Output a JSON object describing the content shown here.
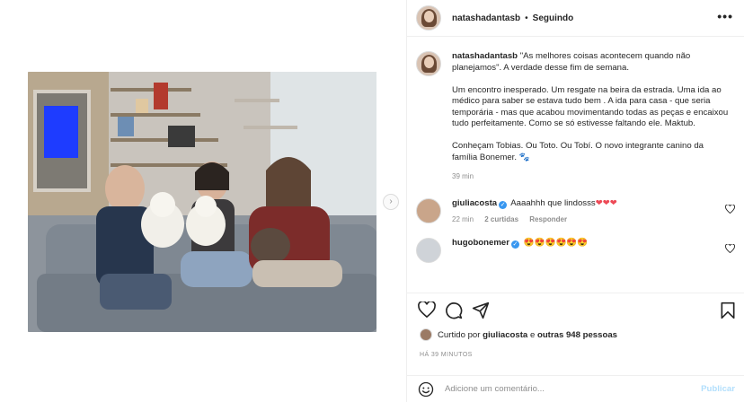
{
  "post": {
    "username": "natashadantasb",
    "separator": "•",
    "follow_status": "Seguindo",
    "more_glyph": "•••"
  },
  "caption": {
    "username": "natashadantasb",
    "paragraph1": "\"As melhores coisas acontecem quando não planejamos\". A verdade desse fim de semana.",
    "paragraph2": "Um encontro inesperado. Um resgate na beira da estrada. Uma ida ao médico para saber se estava tudo bem . A ida para casa - que seria temporária - mas que acabou movimentando todas as peças e encaixou tudo perfeitamente. Como se só estivesse faltando ele. Maktub.",
    "paragraph3": "Conheçam Tobias. Ou Toto. Ou Tobí. O novo integrante canino da família Bonemer. 🐾",
    "time": "39 min"
  },
  "comments": [
    {
      "username": "giuliacosta",
      "verified": true,
      "text": "Aaaahhh que lindosss",
      "hearts": "❤❤❤",
      "time": "22 min",
      "likes": "2 curtidas",
      "reply": "Responder"
    },
    {
      "username": "hugobonemer",
      "verified": true,
      "text": "😍😍😍😍😍😍"
    }
  ],
  "likes": {
    "prefix": "Curtido por",
    "user": "giuliacosta",
    "conj": "e",
    "others": "outras 948 pessoas"
  },
  "timestamp": "HÁ 39 MINUTOS",
  "add_comment": {
    "placeholder": "Adicione um comentário...",
    "post_label": "Publicar"
  },
  "icons": {
    "next": "›"
  },
  "colors": {
    "verified": "#3897f0",
    "post_disabled": "#b2dffc",
    "heart": "#ed4956",
    "meta": "#8e8e8e"
  }
}
